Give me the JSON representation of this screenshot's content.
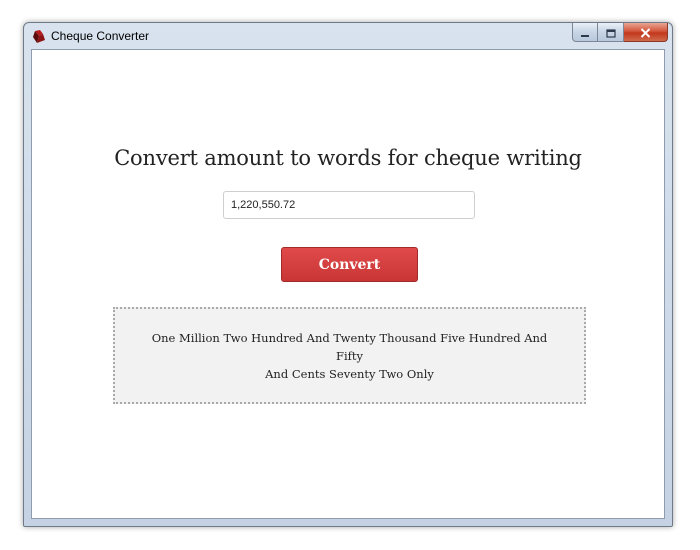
{
  "window": {
    "title": "Cheque Converter",
    "icon": "red-cube-app-icon",
    "controls": [
      "minimize-icon",
      "maximize-icon",
      "close-icon"
    ]
  },
  "main": {
    "heading": "Convert amount to words for cheque writing",
    "amount_input": {
      "value": "1,220,550.72",
      "placeholder": ""
    },
    "convert_button": "Convert",
    "result": {
      "line1": "One Million Two Hundred And Twenty Thousand Five Hundred And Fifty",
      "line2": "And Cents Seventy Two Only"
    }
  },
  "colors": {
    "button": "#cf3a3a",
    "result_bg": "#f2f2f2",
    "result_border": "#a9a9a9"
  }
}
